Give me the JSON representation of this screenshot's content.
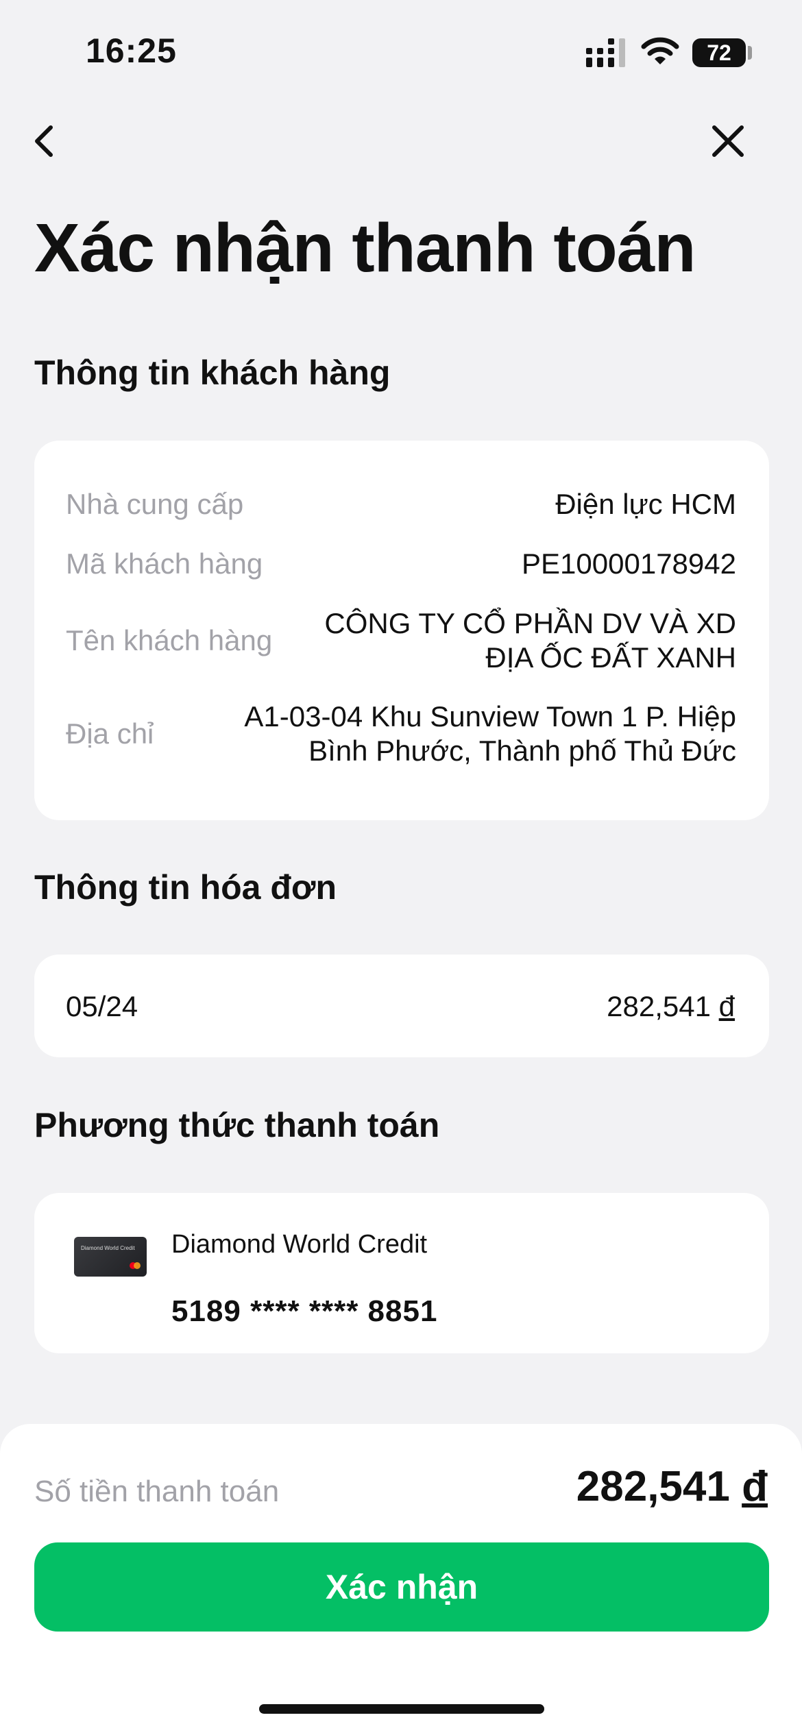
{
  "status_bar": {
    "time": "16:25",
    "battery": "72"
  },
  "page": {
    "title": "Xác nhận thanh toán"
  },
  "customer_section": {
    "title": "Thông tin khách hàng",
    "rows": [
      {
        "label": "Nhà cung cấp",
        "value": "Điện lực HCM"
      },
      {
        "label": "Mã khách hàng",
        "value": "PE10000178942"
      },
      {
        "label": "Tên khách hàng",
        "value_lines": [
          "CÔNG TY CỔ PHẦN DV VÀ XD",
          "ĐỊA ỐC ĐẤT XANH"
        ]
      },
      {
        "label": "Địa chỉ",
        "value_lines": [
          "A1-03-04 Khu Sunview Town 1 P. Hiệp",
          "Bình Phước, Thành phố Thủ Đức"
        ]
      }
    ]
  },
  "bill_section": {
    "title": "Thông tin hóa đơn",
    "period": "05/24",
    "amount": "282,541",
    "currency": "đ"
  },
  "payment_section": {
    "title": "Phương thức thanh toán",
    "card_name": "Diamond World Credit",
    "card_number": "5189 **** **** 8851"
  },
  "footer": {
    "total_label": "Số tiền thanh toán",
    "total_amount": "282,541",
    "currency": "đ",
    "confirm_label": "Xác nhận"
  },
  "colors": {
    "accent": "#04bf65",
    "background": "#f2f2f4",
    "muted": "#a2a2a8"
  },
  "icons": {
    "back": "chevron-left-icon",
    "close": "close-icon"
  }
}
